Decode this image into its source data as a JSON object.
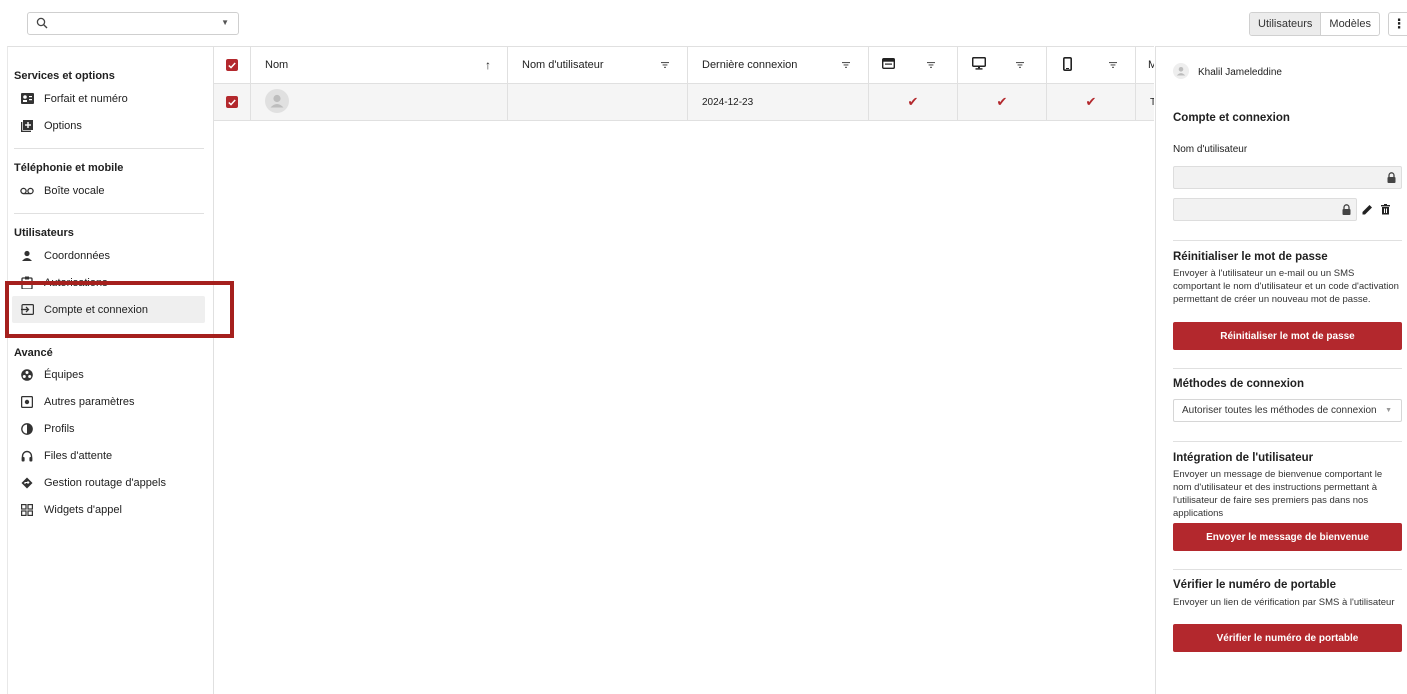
{
  "toolbar": {
    "search_value": "",
    "view_tabs": [
      "Utilisateurs",
      "Modèles"
    ],
    "active_tab": "Utilisateurs",
    "more_label": "⋮"
  },
  "sidebar": {
    "sections": [
      {
        "title": "Services et options",
        "items": [
          {
            "label": "Forfait et numéro",
            "icon": "id-card-icon"
          },
          {
            "label": "Options",
            "icon": "add-box-icon"
          }
        ]
      },
      {
        "title": "Téléphonie et mobile",
        "items": [
          {
            "label": "Boîte vocale",
            "icon": "voicemail-icon"
          }
        ]
      },
      {
        "title": "Utilisateurs",
        "items": [
          {
            "label": "Coordonnées",
            "icon": "person-icon"
          },
          {
            "label": "Autorisations",
            "icon": "clipboard-icon"
          },
          {
            "label": "Compte et connexion",
            "icon": "login-icon",
            "active": true
          }
        ]
      },
      {
        "title": "Avancé",
        "items": [
          {
            "label": "Équipes",
            "icon": "teams-icon"
          },
          {
            "label": "Autres paramètres",
            "icon": "settings-box-icon"
          },
          {
            "label": "Profils",
            "icon": "contrast-icon"
          },
          {
            "label": "Files d'attente",
            "icon": "headset-icon"
          },
          {
            "label": "Gestion routage d'appels",
            "icon": "routing-icon"
          },
          {
            "label": "Widgets d'appel",
            "icon": "widgets-icon"
          }
        ]
      }
    ]
  },
  "table": {
    "columns": [
      "Nom",
      "Nom d'utilisateur",
      "Dernière connexion",
      "",
      "",
      "",
      "M"
    ],
    "rows": [
      {
        "name": "",
        "username": "",
        "last_login": "2024-12-23",
        "web": "✔",
        "desktop": "✔",
        "mobile": "✔",
        "extra": "T"
      }
    ]
  },
  "panel": {
    "user_name": "Khalil Jameleddine",
    "section_title": "Compte et connexion",
    "username_label": "Nom d'utilisateur",
    "reset": {
      "title": "Réinitialiser le mot de passe",
      "text": "Envoyer à l'utilisateur un e-mail ou un SMS comportant le nom d'utilisateur et un code d'activation permettant de créer un nouveau mot de passe.",
      "button": "Réinitialiser le mot de passe"
    },
    "login_methods": {
      "title": "Méthodes de connexion",
      "value": "Autoriser toutes les méthodes de connexion"
    },
    "onboarding": {
      "title": "Intégration de l'utilisateur",
      "text": "Envoyer un message de bienvenue comportant le nom d'utilisateur et des instructions permettant à l'utilisateur de faire ses premiers pas dans nos applications",
      "button": "Envoyer le message de bienvenue"
    },
    "verify": {
      "title": "Vérifier le numéro de portable",
      "text": "Envoyer un lien de vérification par SMS à l'utilisateur",
      "button": "Vérifier le numéro de portable"
    }
  },
  "colors": {
    "accent": "#b3282d",
    "highlight_box": "#a5201d"
  }
}
